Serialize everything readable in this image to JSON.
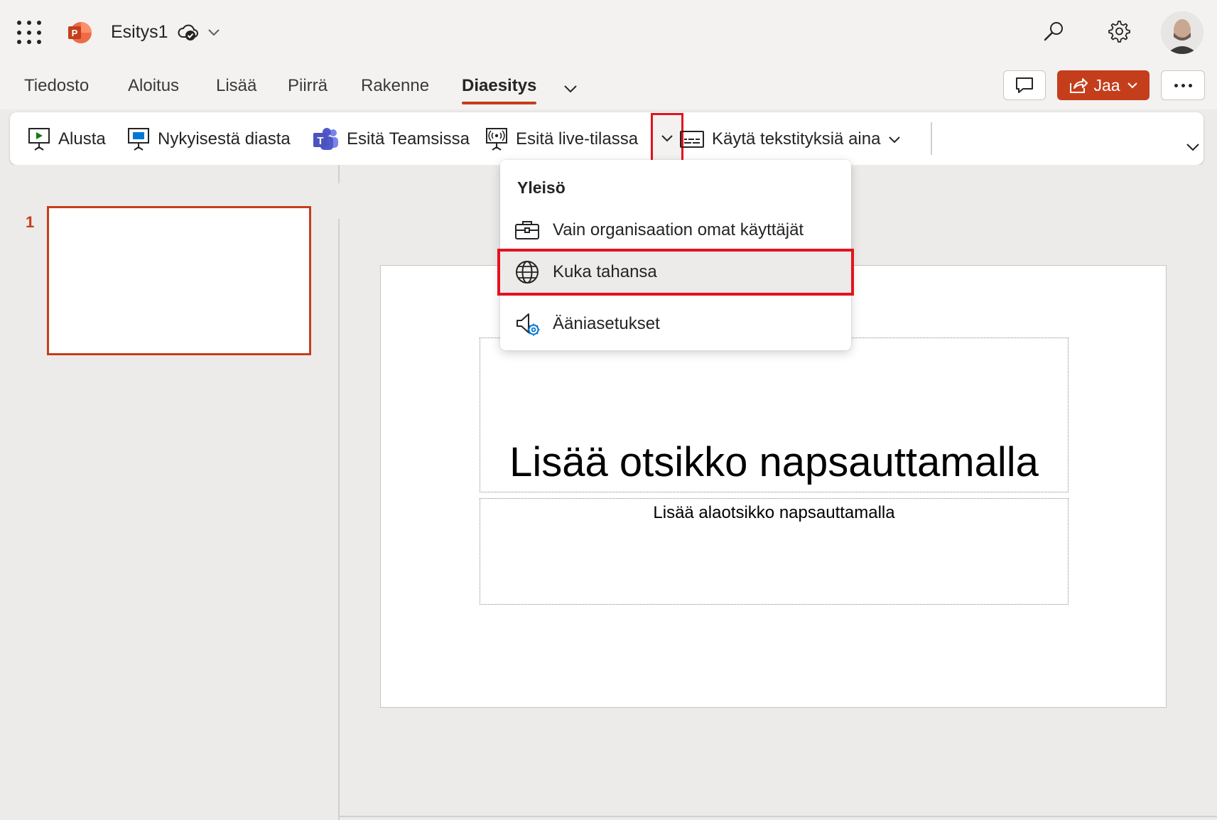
{
  "app": {
    "document_title": "Esitys1"
  },
  "tabs": [
    {
      "label": "Tiedosto"
    },
    {
      "label": "Aloitus"
    },
    {
      "label": "Lisää"
    },
    {
      "label": "Piirrä"
    },
    {
      "label": "Rakenne"
    },
    {
      "label": "Diaesitys",
      "active": true
    }
  ],
  "header_actions": {
    "share_label": "Jaa",
    "accent_color": "#c43e1c"
  },
  "ribbon": {
    "items": [
      {
        "label": "Alusta",
        "icon": "present-from-start-icon"
      },
      {
        "label": "Nykyisestä diasta",
        "icon": "present-from-current-icon"
      },
      {
        "label": "Esitä Teamsissa",
        "icon": "teams-icon"
      },
      {
        "label": "Esitä live-tilassa",
        "icon": "present-live-icon"
      },
      {
        "label": "Käytä tekstityksiä aina",
        "icon": "subtitles-icon"
      }
    ]
  },
  "dropdown": {
    "header": "Yleisö",
    "items": [
      {
        "label": "Vain organisaation omat käyttäjät",
        "icon": "briefcase-icon"
      },
      {
        "label": "Kuka tahansa",
        "icon": "globe-icon",
        "selected": true
      },
      {
        "label": "Ääniasetukset",
        "icon": "speaker-settings-icon"
      }
    ]
  },
  "thumbnails": [
    {
      "number": "1"
    }
  ],
  "slide": {
    "title_placeholder": "Lisää otsikko napsauttamalla",
    "subtitle_placeholder": "Lisää alaotsikko napsauttamalla"
  },
  "highlight_color": "#e3121f"
}
